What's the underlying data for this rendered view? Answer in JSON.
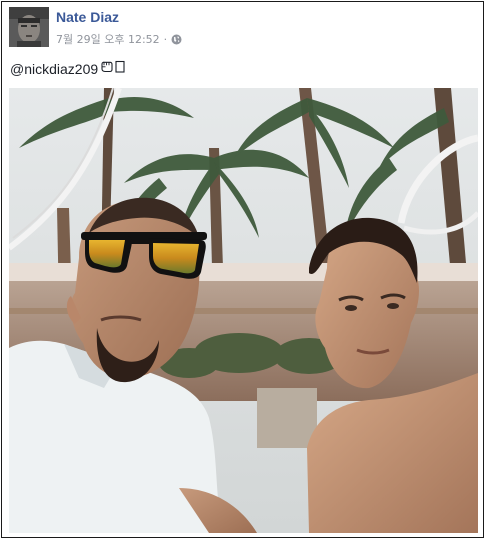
{
  "post": {
    "author_name": "Nate Diaz",
    "timestamp": "7월 29일 오후 12:52",
    "separator": "·",
    "privacy_icon": "globe-icon",
    "text": "@nickdiaz209",
    "emoji_icon": "fist-bump-emoji"
  },
  "colors": {
    "author_link": "#3b5998",
    "meta_text": "#90949c",
    "body_text": "#1d2129",
    "card_border": "#1a1a1a"
  }
}
